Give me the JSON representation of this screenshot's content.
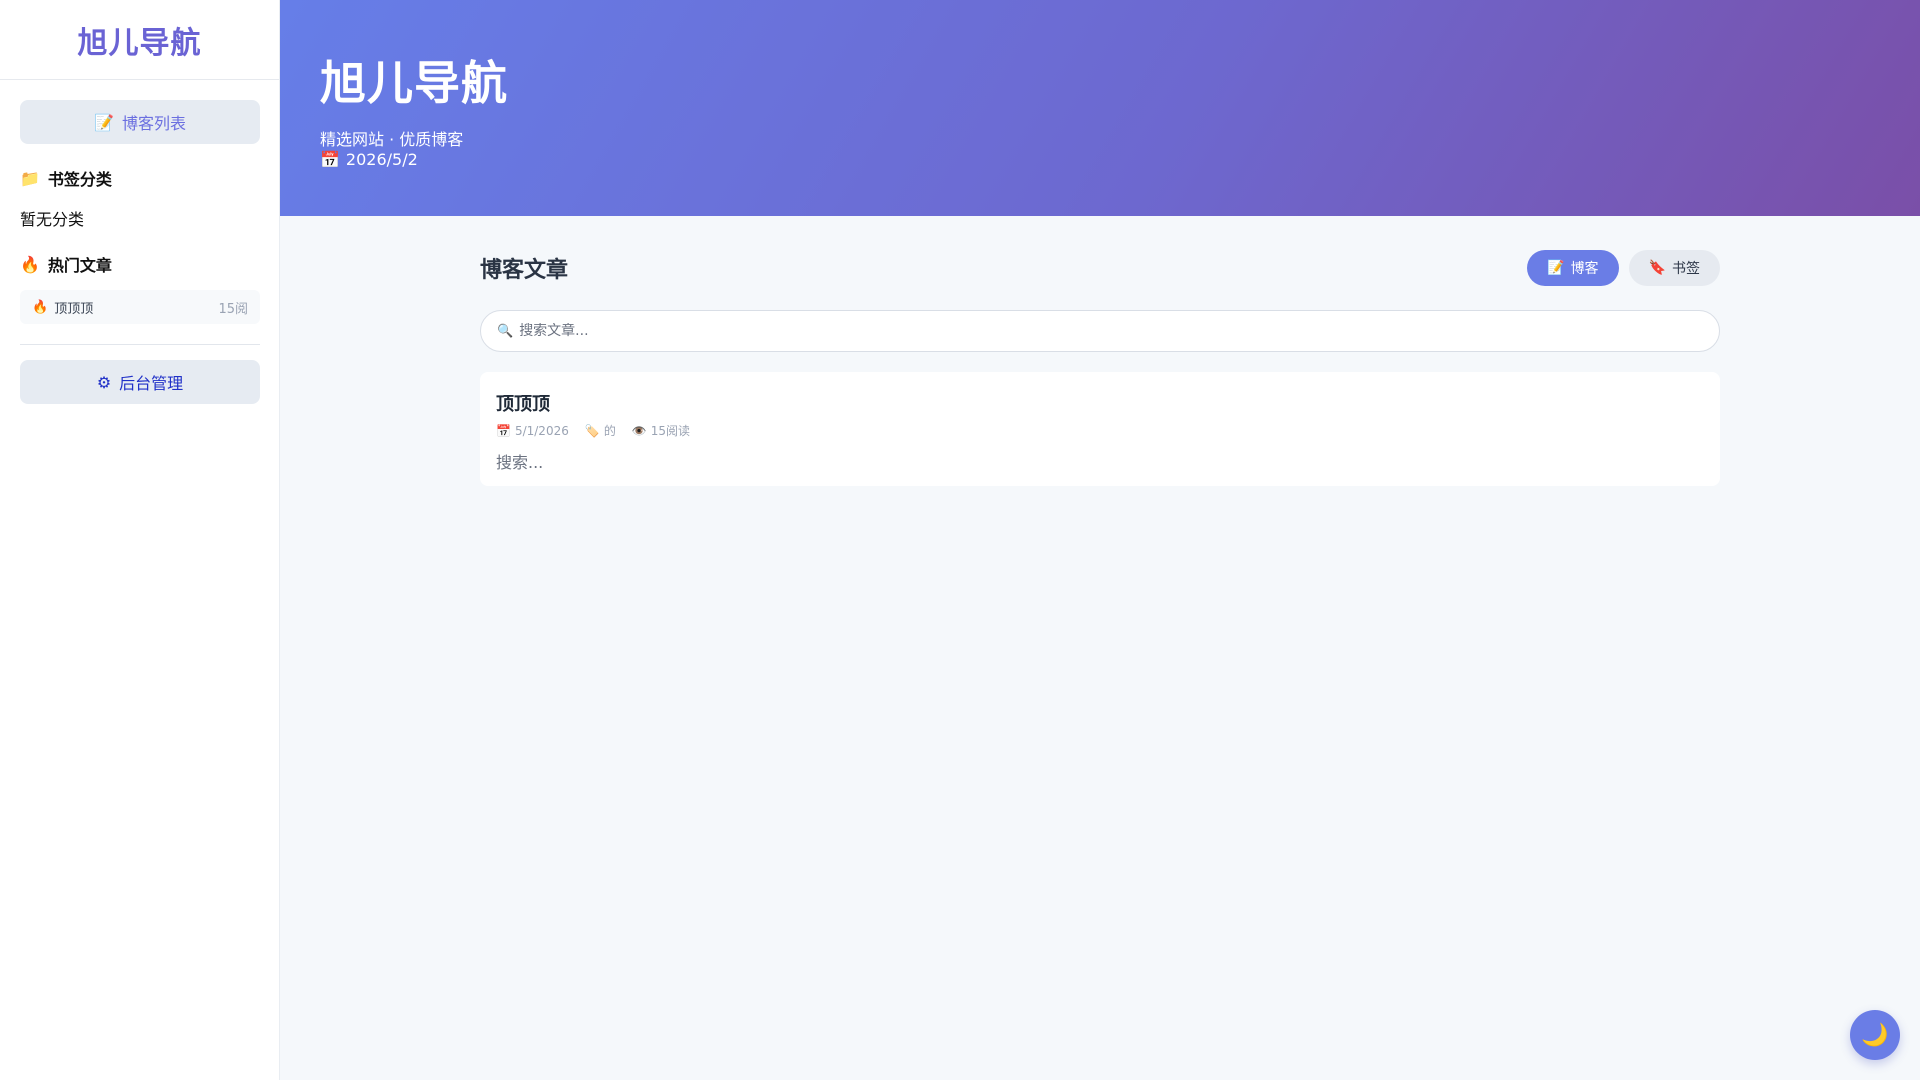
{
  "sidebar": {
    "brand": "旭儿导航",
    "blog_button": {
      "icon": "📝",
      "label": "博客列表"
    },
    "bookmark_section": {
      "icon": "📁",
      "title": "书签分类",
      "empty_text": "暂无分类"
    },
    "hot_section": {
      "icon": "🔥",
      "title": "热门文章",
      "items": [
        {
          "icon": "🔥",
          "title": "顶顶顶",
          "views": "15阅"
        }
      ]
    },
    "admin_button": {
      "icon": "⚙",
      "label": "后台管理"
    }
  },
  "hero": {
    "title": "旭儿导航",
    "subtitle": "精选网站 · 优质博客",
    "date_icon": "📅",
    "date": "2026/5/2"
  },
  "main": {
    "title": "博客文章",
    "tabs": [
      {
        "icon": "📝",
        "label": "博客",
        "active": true
      },
      {
        "icon": "🔖",
        "label": "书签",
        "active": false
      }
    ],
    "search": {
      "icon": "🔍",
      "placeholder": "搜索文章..."
    },
    "articles": [
      {
        "title": "顶顶顶",
        "date_icon": "📅",
        "date": "5/1/2026",
        "tag_icon": "🏷️",
        "tag": "的",
        "views_icon": "👁️",
        "views": "15阅读",
        "excerpt": "搜索..."
      }
    ]
  },
  "theme_toggle": {
    "icon": "🌙"
  },
  "colors": {
    "accent": "#6a7de6",
    "hero_gradient_start": "#667ee8",
    "hero_gradient_end": "#7a4fa8",
    "brand_text": "#6a63d4"
  }
}
